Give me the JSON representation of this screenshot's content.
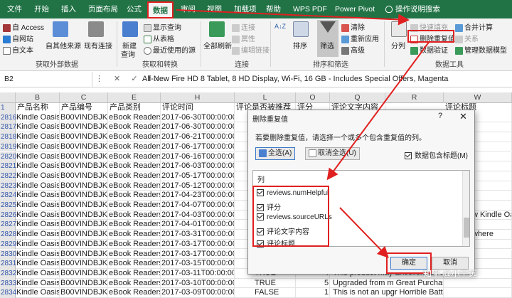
{
  "tabs": [
    "文件",
    "开始",
    "插入",
    "页面布局",
    "公式",
    "数据",
    "审阅",
    "视图",
    "加载项",
    "帮助",
    "WPS PDF",
    "Power Pivot",
    "操作说明搜索"
  ],
  "active_tab": "数据",
  "ribbon": {
    "external": {
      "access": "自 Access",
      "web": "自网站",
      "text": "自文本",
      "other": "自其他来源",
      "existing": "现有连接",
      "label": "获取外部数据"
    },
    "transform": {
      "new_query": "新建",
      "new_query2": "查询",
      "show_query": "显示查询",
      "from_table": "从表格",
      "recent": "最近使用的源",
      "label": "获取和转换"
    },
    "connections": {
      "refresh_all": "全部刷新",
      "connect": "连接",
      "properties": "属性",
      "edit_links": "编辑链接",
      "label": "连接"
    },
    "sort": {
      "sort_az": "A↓Z",
      "sort": "排序",
      "filter": "筛选",
      "clear": "清除",
      "reapply": "重新应用",
      "advanced": "高级",
      "label": "排序和筛选"
    },
    "tools": {
      "split": "分列",
      "fill": "快速填充",
      "remove_dup": "删除重复值",
      "validation": "数据验证",
      "consolidate": "合并计算",
      "relations": "关系",
      "model": "管理数据模型",
      "label": "数据工具"
    }
  },
  "formula_bar": {
    "namebox": "B2",
    "buttons": "⋮ ✕ ✓ fx",
    "formula": "All-New Fire HD 8 Tablet, 8 HD Display, Wi-Fi, 16 GB - Includes Special Offers, Magenta"
  },
  "columns": [
    "A",
    "B",
    "C",
    "E",
    "H",
    "L",
    "O",
    "Q",
    "R",
    "W"
  ],
  "header_row": {
    "num": "1",
    "cells": [
      "产品名称",
      "产品编号",
      "产品类别",
      "评论时间",
      "评论是否被推荐",
      "评分",
      "评论文字内容",
      "评论标题"
    ]
  },
  "rows": [
    {
      "num": "2816",
      "name": "Kindle Oasis",
      "code": "B00VINDBJK",
      "cat": "eBook Readers,",
      "time": "2017-06-30T00:00:00",
      "rec": "",
      "score": "",
      "text": "",
      "title": ""
    },
    {
      "num": "2817",
      "name": "Kindle Oasis",
      "code": "B00VINDBJK",
      "cat": "eBook Readers,",
      "time": "2017-06-30T00:00:00",
      "rec": "",
      "score": "",
      "text": "",
      "title": ""
    },
    {
      "num": "2818",
      "name": "Kindle Oasis",
      "code": "B00VINDBJK",
      "cat": "eBook Readers,",
      "time": "2017-06-21T00:00:00",
      "rec": "",
      "score": "",
      "text": "",
      "title": ""
    },
    {
      "num": "2819",
      "name": "Kindle Oasis",
      "code": "B00VINDBJK",
      "cat": "eBook Readers,",
      "time": "2017-06-17T00:00:00",
      "rec": "",
      "score": "",
      "text": "",
      "title": ""
    },
    {
      "num": "2820",
      "name": "Kindle Oasis",
      "code": "B00VINDBJK",
      "cat": "eBook Readers,",
      "time": "2017-06-16T00:00:00",
      "rec": "",
      "score": "",
      "text": "",
      "title": ""
    },
    {
      "num": "2821",
      "name": "Kindle Oasis",
      "code": "B00VINDBJK",
      "cat": "eBook Readers,",
      "time": "2017-06-03T00:00:00",
      "rec": "",
      "score": "",
      "text": "",
      "title": ""
    },
    {
      "num": "2822",
      "name": "Kindle Oasis",
      "code": "B00VINDBJK",
      "cat": "eBook Readers,",
      "time": "2017-05-17T00:00:00",
      "rec": "",
      "score": "",
      "text": "",
      "title": ""
    },
    {
      "num": "2823",
      "name": "Kindle Oasis",
      "code": "B00VINDBJK",
      "cat": "eBook Readers,",
      "time": "2017-05-12T00:00:00",
      "rec": "",
      "score": "",
      "text": "",
      "title": ""
    },
    {
      "num": "2824",
      "name": "Kindle Oasis",
      "code": "B00VINDBJK",
      "cat": "eBook Readers,",
      "time": "2017-04-23T00:00:00",
      "rec": "",
      "score": "",
      "text": "",
      "title": ""
    },
    {
      "num": "2825",
      "name": "Kindle Oasis",
      "code": "B00VINDBJK",
      "cat": "eBook Readers,",
      "time": "2017-04-07T00:00:00",
      "rec": "",
      "score": "",
      "text": "",
      "title": ""
    },
    {
      "num": "2826",
      "name": "Kindle Oasis",
      "code": "B00VINDBJK",
      "cat": "eBook Readers,",
      "time": "2017-04-03T00:00:00",
      "rec": "",
      "score": "",
      "text": "",
      "title": "w Kindle Oa"
    },
    {
      "num": "2827",
      "name": "Kindle Oasis",
      "code": "B00VINDBJK",
      "cat": "eBook Readers,",
      "time": "2017-04-01T00:00:00",
      "rec": "",
      "score": "",
      "text": "",
      "title": ""
    },
    {
      "num": "2828",
      "name": "Kindle Oasis",
      "code": "B00VINDBJK",
      "cat": "eBook Readers,",
      "time": "2017-03-31T00:00:00",
      "rec": "",
      "score": "",
      "text": "",
      "title": "where"
    },
    {
      "num": "2829",
      "name": "Kindle Oasis",
      "code": "B00VINDBJK",
      "cat": "eBook Readers,",
      "time": "2017-03-17T00:00:00",
      "rec": "",
      "score": "",
      "text": "",
      "title": ""
    },
    {
      "num": "2830",
      "name": "Kindle Oasis",
      "code": "B00VINDBJK",
      "cat": "eBook Readers,",
      "time": "2017-03-17T00:00:00",
      "rec": "",
      "score": "",
      "text": "",
      "title": ""
    },
    {
      "num": "2831",
      "name": "Kindle Oasis",
      "code": "B00VINDBJK",
      "cat": "eBook Readers,",
      "time": "2017-03-15T00:00:00",
      "rec": "",
      "score": "",
      "text": "",
      "title": ""
    },
    {
      "num": "2832",
      "name": "Kindle Oasis",
      "code": "B00VINDBJK",
      "cat": "eBook Readers,",
      "time": "2017-03-11T00:00:00",
      "rec": "TRUE",
      "score": "4",
      "text": "This product may  Excellent E-Re",
      "title": ""
    },
    {
      "num": "2833",
      "name": "Kindle Oasis",
      "code": "B00VINDBJK",
      "cat": "eBook Readers,",
      "time": "2017-03-10T00:00:00",
      "rec": "TRUE",
      "score": "5",
      "text": "Upgraded from m Great Purchase",
      "title": ""
    },
    {
      "num": "2834",
      "name": "Kindle Oasis",
      "code": "B00VINDBJK",
      "cat": "eBook Readers,",
      "time": "2017-03-09T00:00:00",
      "rec": "FALSE",
      "score": "1",
      "text": "This is not an upgr Horrible Battery Life",
      "title": ""
    }
  ],
  "dialog": {
    "title": "删除重复值",
    "help": "?",
    "close": "✕",
    "instruction": "若要删除重复值，请选择一个或多个包含重复值的列。",
    "select_all": "全选(A)",
    "unselect_all": "取消全选(U)",
    "has_headers": "数据包含标题(M)",
    "list_header": "列",
    "items": [
      "reviews.numHelpful",
      "评分",
      "reviews.sourceURLs",
      "评论文字内容",
      "评论标题"
    ],
    "ok": "确定",
    "cancel": "取消"
  },
  "watermark": "知乎 @小宁远",
  "colors": {
    "excel_green": "#217346",
    "highlight_red": "#e02020"
  }
}
